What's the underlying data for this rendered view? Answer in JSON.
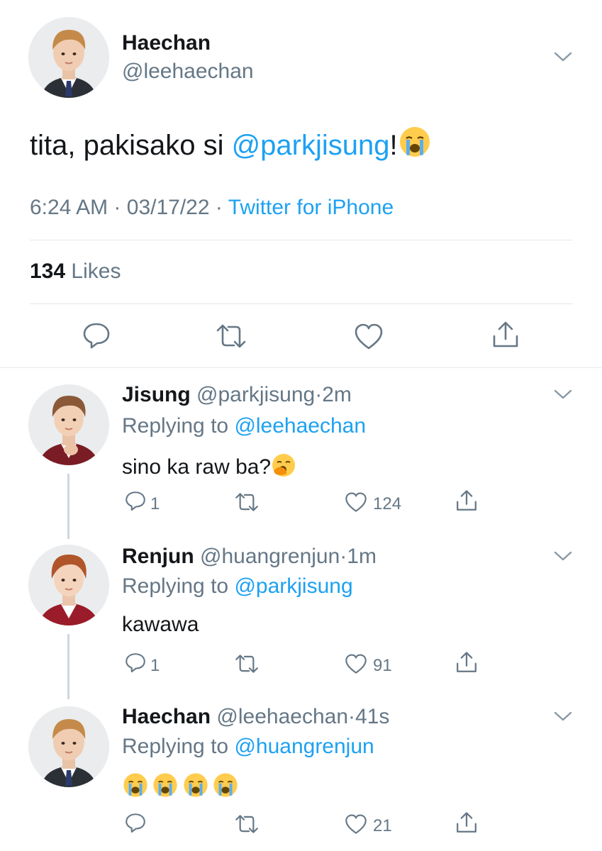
{
  "main_tweet": {
    "name": "Haechan",
    "handle": "@leehaechan",
    "text_before": "tita, pakisako si ",
    "mention": "@parkjisung",
    "text_after": "!",
    "time": "6:24 AM",
    "dot1": "·",
    "date": "03/17/22",
    "dot2": "·",
    "source": "Twitter for iPhone",
    "likes_count": "134",
    "likes_label": "Likes"
  },
  "replies": [
    {
      "name": "Jisung",
      "handle": "@parkjisung",
      "dot": "·",
      "age": "2m",
      "replying_label": "Replying to ",
      "replying_to": "@leehaechan",
      "text": "sino ka raw ba?",
      "reply_count": "1",
      "like_count": "124"
    },
    {
      "name": "Renjun",
      "handle": "@huangrenjun",
      "dot": "·",
      "age": "1m",
      "replying_label": "Replying to ",
      "replying_to": "@parkjisung",
      "text": "kawawa",
      "reply_count": "1",
      "like_count": "91"
    },
    {
      "name": "Haechan",
      "handle": "@leehaechan",
      "dot": "·",
      "age": "41s",
      "replying_label": "Replying to ",
      "replying_to": "@huangrenjun",
      "text": "",
      "reply_count": "",
      "like_count": "21"
    }
  ],
  "colors": {
    "link_blue": "#1da1f2",
    "secondary_gray": "#657786",
    "divider": "#e1e8ed"
  },
  "icons": [
    "chevron-down-icon",
    "reply-icon",
    "retweet-icon",
    "heart-icon",
    "share-icon",
    "loudly-crying-emoji",
    "yawning-emoji"
  ]
}
